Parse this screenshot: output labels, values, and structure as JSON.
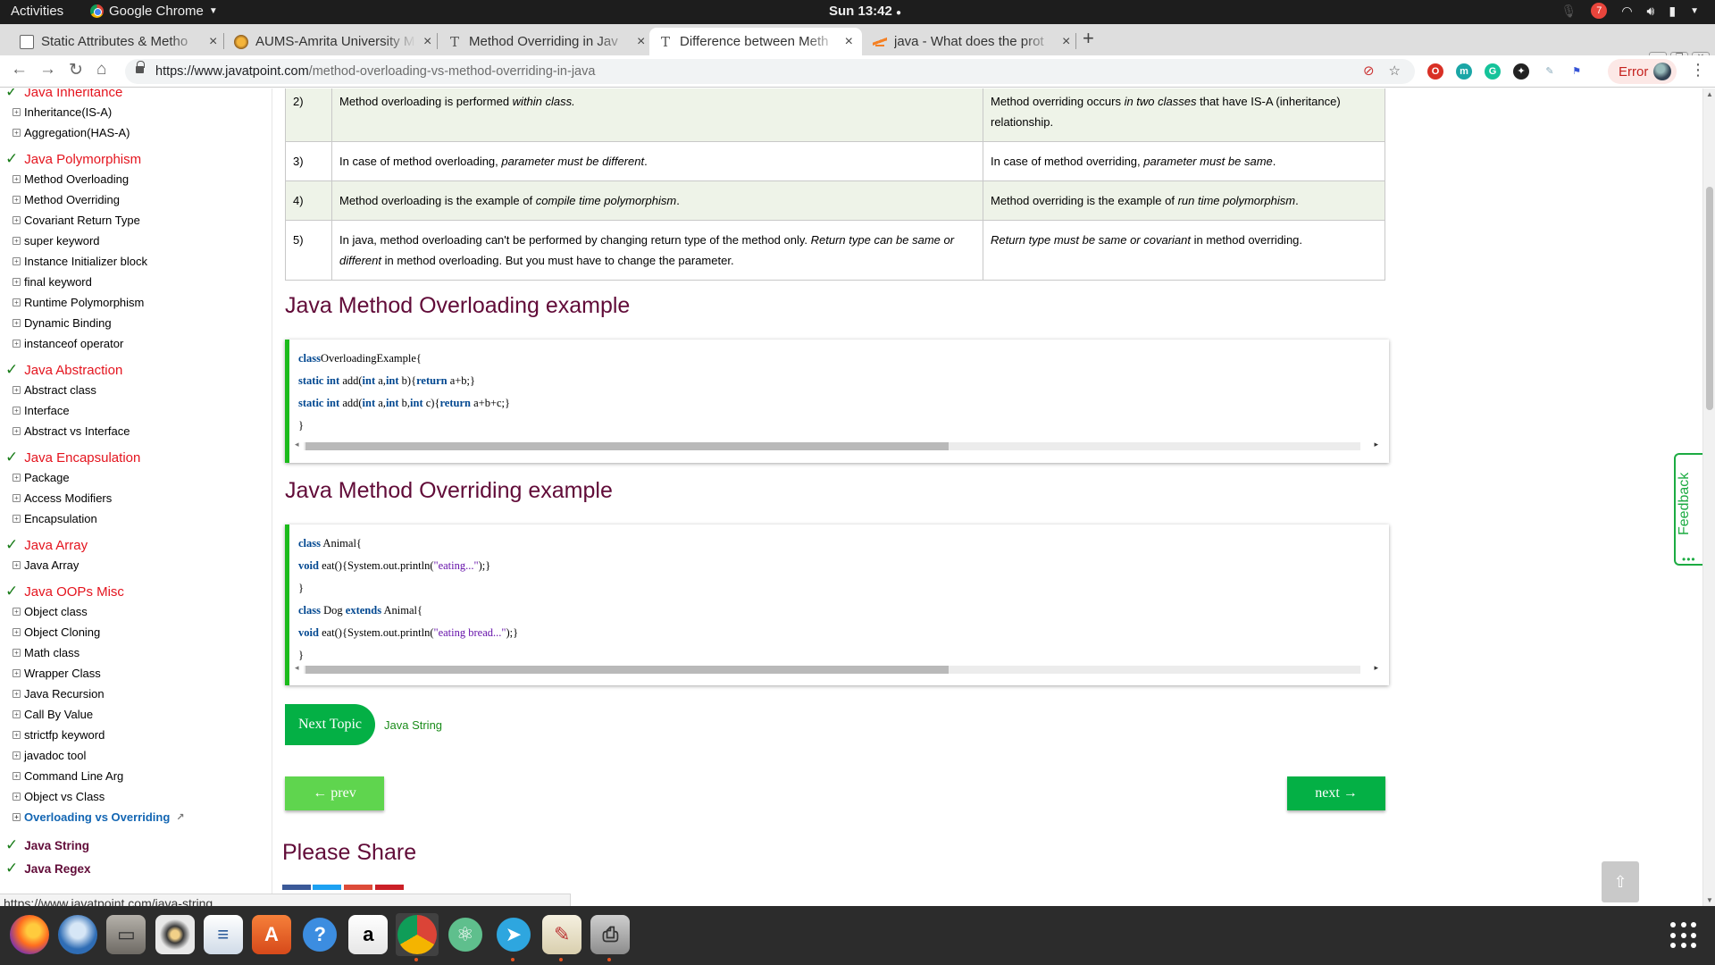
{
  "topbar": {
    "activities": "Activities",
    "app_name": "Google Chrome",
    "clock": "Sun 13:42",
    "notif_count": "7"
  },
  "tabs": [
    {
      "title": "Static Attributes & Metho",
      "icon": "document-icon"
    },
    {
      "title": "AUMS-Amrita University M",
      "icon": "amrita-icon"
    },
    {
      "title": "Method Overriding in Jav",
      "icon": "text-t-icon"
    },
    {
      "title": "Difference between Meth",
      "icon": "text-t-icon",
      "active": true
    },
    {
      "title": "java - What does the prot",
      "icon": "stackoverflow-icon"
    }
  ],
  "toolbar": {
    "url_host": "https://www.javatpoint.com",
    "url_path": "/method-overloading-vs-method-overriding-in-java",
    "error_label": "Error"
  },
  "sidebar": {
    "groups": [
      {
        "title": "Java Inheritance",
        "items": [
          "Inheritance(IS-A)",
          "Aggregation(HAS-A)"
        ]
      },
      {
        "title": "Java Polymorphism",
        "items": [
          "Method Overloading",
          "Method Overriding",
          "Covariant Return Type",
          "super keyword",
          "Instance Initializer block",
          "final keyword",
          "Runtime Polymorphism",
          "Dynamic Binding",
          "instanceof operator"
        ]
      },
      {
        "title": "Java Abstraction",
        "items": [
          "Abstract class",
          "Interface",
          "Abstract vs Interface"
        ]
      },
      {
        "title": "Java Encapsulation",
        "items": [
          "Package",
          "Access Modifiers",
          "Encapsulation"
        ]
      },
      {
        "title": "Java Array",
        "items": [
          "Java Array"
        ]
      },
      {
        "title": "Java OOPs Misc",
        "items": [
          "Object class",
          "Object Cloning",
          "Math class",
          "Wrapper Class",
          "Java Recursion",
          "Call By Value",
          "strictfp keyword",
          "javadoc tool",
          "Command Line Arg",
          "Object vs Class",
          "Overloading vs Overriding"
        ]
      }
    ],
    "bottom_heads": [
      "Java String",
      "Java Regex"
    ]
  },
  "table": {
    "rows": [
      {
        "num": "2)",
        "c1": "Method overloading is performed <i>within class.</i>",
        "c2": "Method overriding occurs <i>in two classes</i> that have IS-A (inheritance) relationship."
      },
      {
        "num": "3)",
        "c1": "In case of method overloading, <i>parameter must be different</i>.",
        "c2": "In case of method overriding, <i>parameter must be same</i>."
      },
      {
        "num": "4)",
        "c1": "Method overloading is the example of <i>compile time polymorphism</i>.",
        "c2": "Method overriding is the example of <i>run time polymorphism</i>."
      },
      {
        "num": "5)",
        "c1": "In java, method overloading can't be performed by changing return type of the method only. <i>Return type can be same or different</i> in method overloading. But you must have to change the parameter.",
        "c2": "<i>Return type must be same or covariant</i> in method overriding."
      }
    ]
  },
  "overloading": {
    "heading": "Java Method Overloading example",
    "code": [
      [
        [
          "kw",
          "class"
        ],
        [
          "",
          "OverloadingExample{"
        ]
      ],
      [
        [
          "kw",
          "static int"
        ],
        [
          "",
          " add("
        ],
        [
          "kw",
          "int"
        ],
        [
          "",
          " a,"
        ],
        [
          "kw",
          "int"
        ],
        [
          "",
          " b){"
        ],
        [
          "kw",
          "return"
        ],
        [
          "",
          " a+b;}"
        ]
      ],
      [
        [
          "kw",
          "static int"
        ],
        [
          "",
          " add("
        ],
        [
          "kw",
          "int"
        ],
        [
          "",
          " a,"
        ],
        [
          "kw",
          "int"
        ],
        [
          "",
          " b,"
        ],
        [
          "kw",
          "int"
        ],
        [
          "",
          " c){"
        ],
        [
          "kw",
          "return"
        ],
        [
          "",
          " a+b+c;}"
        ]
      ],
      [
        [
          "",
          "}"
        ]
      ]
    ]
  },
  "overriding": {
    "heading": "Java Method Overriding example",
    "code": [
      [
        [
          "kw",
          "class"
        ],
        [
          "",
          " Animal{"
        ]
      ],
      [
        [
          "kw",
          "void"
        ],
        [
          "",
          " eat(){System.out.println("
        ],
        [
          "str",
          "\"eating...\""
        ],
        [
          "",
          ");}"
        ]
      ],
      [
        [
          "",
          "}"
        ]
      ],
      [
        [
          "kw",
          "class"
        ],
        [
          "",
          " Dog "
        ],
        [
          "kw",
          "extends"
        ],
        [
          "",
          " Animal{"
        ]
      ],
      [
        [
          "kw",
          "void"
        ],
        [
          "",
          " eat(){System.out.println("
        ],
        [
          "str",
          "\"eating bread...\""
        ],
        [
          "",
          ");}"
        ]
      ],
      [
        [
          "",
          "}"
        ]
      ]
    ]
  },
  "next_topic": {
    "label": "Next Topic",
    "link": "Java String"
  },
  "pager": {
    "prev": "← prev",
    "next": "next →"
  },
  "please_share": "Please Share",
  "feedback": "Feedback",
  "status_url": "https://www.javatpoint.com/java-string",
  "dock": [
    "firefox-icon",
    "thunderbird-icon",
    "files-icon",
    "rhythmbox-icon",
    "libreoffice-writer-icon",
    "software-center-icon",
    "help-icon",
    "amazon-icon",
    "chrome-icon",
    "atom-icon",
    "telegram-icon",
    "text-editor-icon",
    "printer-icon"
  ],
  "colors": {
    "accent_green": "#04b045",
    "heading_maroon": "#610b38",
    "sidebar_red": "#e4141e"
  }
}
